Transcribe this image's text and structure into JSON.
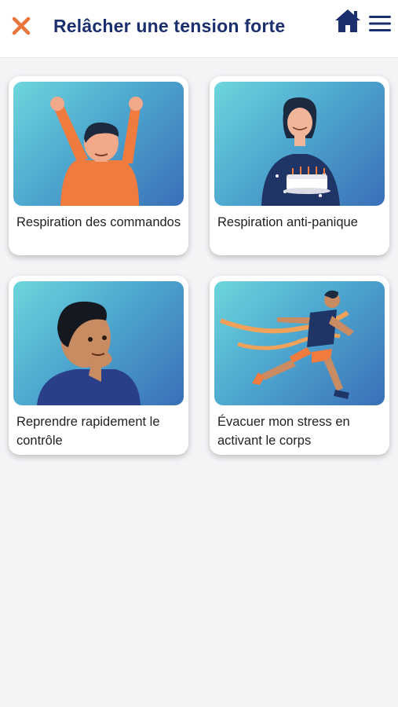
{
  "header": {
    "title": "Relâcher une tension forte",
    "close_icon": "close-icon",
    "home_icon": "home-icon",
    "menu_icon": "hamburger-menu-icon"
  },
  "colors": {
    "accent": "#e8743b",
    "brand": "#1b2f6e",
    "card_gradient_start": "#6dd6dc",
    "card_gradient_end": "#3a6fb8"
  },
  "cards": [
    {
      "label": "Respiration des commandos",
      "illustration": "man-arms-raised-illustration"
    },
    {
      "label": "Respiration anti-panique",
      "illustration": "woman-with-birthday-cake-illustration"
    },
    {
      "label": "Reprendre rapidement le contrôle",
      "illustration": "man-thinking-illustration"
    },
    {
      "label": "Évacuer mon stress en activant le corps",
      "illustration": "runner-finish-line-illustration"
    }
  ]
}
